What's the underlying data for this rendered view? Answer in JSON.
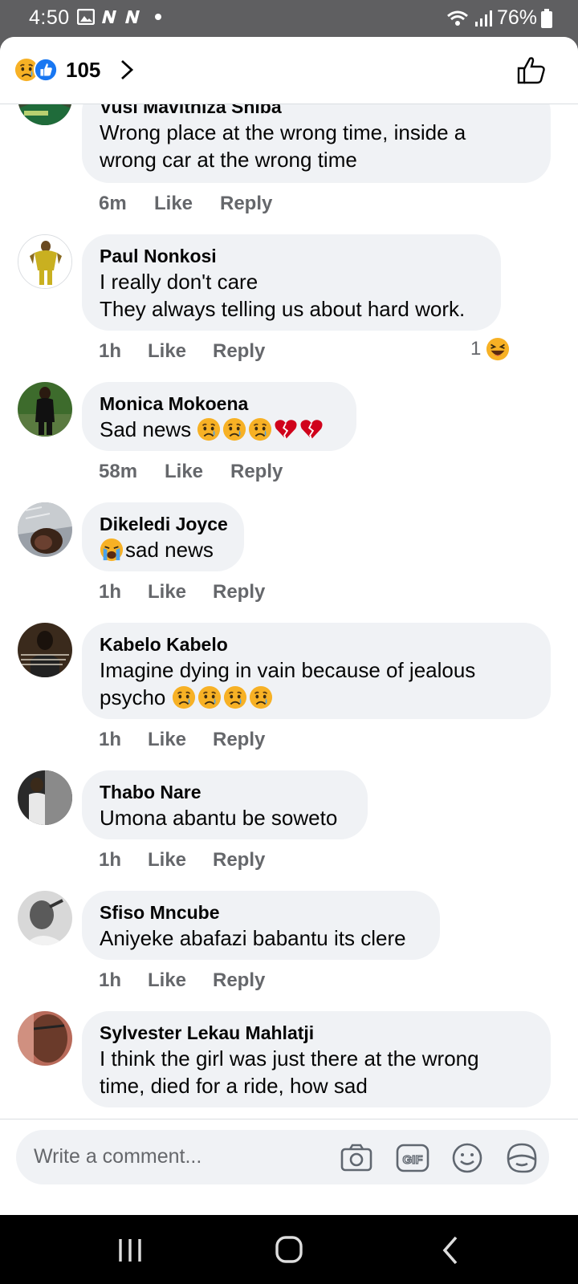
{
  "status_bar": {
    "time": "4:50",
    "battery": "76%"
  },
  "header": {
    "reaction_count": "105"
  },
  "comments": [
    {
      "name": "Vusi Mavithiza Shiba",
      "text": "Wrong place at the wrong time, inside a\nwrong car at the wrong time",
      "time": "6m",
      "like": "Like",
      "reply": "Reply"
    },
    {
      "name": "Paul Nonkosi",
      "text": "I really don't care\nThey always telling us about hard work.",
      "time": "1h",
      "like": "Like",
      "reply": "Reply",
      "reaction_count": "1"
    },
    {
      "name": "Monica Mokoena",
      "text": "Sad news",
      "time": "58m",
      "like": "Like",
      "reply": "Reply"
    },
    {
      "name": "Dikeledi Joyce",
      "text": "sad news",
      "time": "1h",
      "like": "Like",
      "reply": "Reply"
    },
    {
      "name": "Kabelo Kabelo",
      "text_line1": "Imagine dying in vain because of jealous",
      "text_line2": "psycho",
      "time": "1h",
      "like": "Like",
      "reply": "Reply"
    },
    {
      "name": "Thabo Nare",
      "text": "Umona abantu be soweto",
      "time": "1h",
      "like": "Like",
      "reply": "Reply"
    },
    {
      "name": "Sfiso Mncube",
      "text": "Aniyeke abafazi babantu its clere",
      "time": "1h",
      "like": "Like",
      "reply": "Reply"
    },
    {
      "name": "Sylvester Lekau Mahlatji",
      "text": "I think the girl was just there at the wrong\ntime, died for a ride, how sad"
    }
  ],
  "composer": {
    "placeholder": "Write a comment..."
  },
  "colors": {
    "bubble": "#f0f2f5",
    "meta": "#65676b",
    "facebook_blue": "#1877f2",
    "status_bar": "#5f5f61"
  },
  "icons": [
    "sad-reaction-icon",
    "like-reaction-icon",
    "chevron-right-icon",
    "thumbs-up-icon",
    "crying-face-icon",
    "broken-heart-icon",
    "loudly-crying-face-icon",
    "laughing-face-icon",
    "camera-icon",
    "gif-icon",
    "smiley-icon",
    "sticker-icon",
    "recent-apps-icon",
    "home-icon",
    "back-icon"
  ]
}
